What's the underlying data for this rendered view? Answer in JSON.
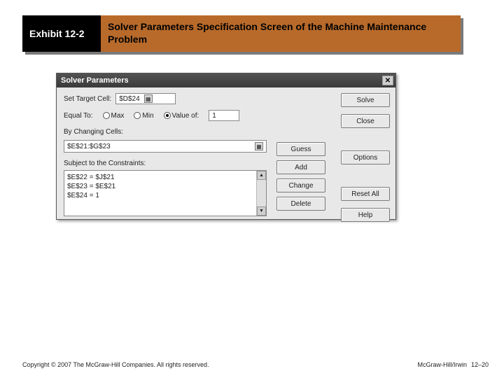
{
  "header": {
    "exhibit_label": "Exhibit 12-2",
    "caption": "Solver Parameters Specification Screen of the Machine Maintenance Problem"
  },
  "dialog": {
    "title": "Solver Parameters",
    "close_glyph": "✕",
    "target_cell_label": "Set Target Cell:",
    "target_cell_value": "$D$24",
    "equal_to_label": "Equal To:",
    "radios": {
      "max": "Max",
      "min": "Min",
      "value_of": "Value of:"
    },
    "value_of_field": "1",
    "changing_cells_label": "By Changing Cells:",
    "changing_cells_value": "$E$21:$G$23",
    "constraints_label": "Subject to the Constraints:",
    "constraints": [
      "$E$22 = $J$21",
      "$E$23 = $E$21",
      "$E$24 = 1"
    ],
    "scroll": {
      "up": "▲",
      "down": "▼"
    },
    "buttons": {
      "solve": "Solve",
      "close": "Close",
      "options": "Options",
      "reset": "Reset All",
      "help": "Help",
      "guess": "Guess",
      "add": "Add",
      "change": "Change",
      "delete": "Delete"
    },
    "picker_glyph": "▦"
  },
  "footer": {
    "copyright": "Copyright © 2007 The McGraw-Hill Companies. All rights reserved.",
    "publisher": "McGraw-Hill/Irwin",
    "page": "12–20"
  }
}
